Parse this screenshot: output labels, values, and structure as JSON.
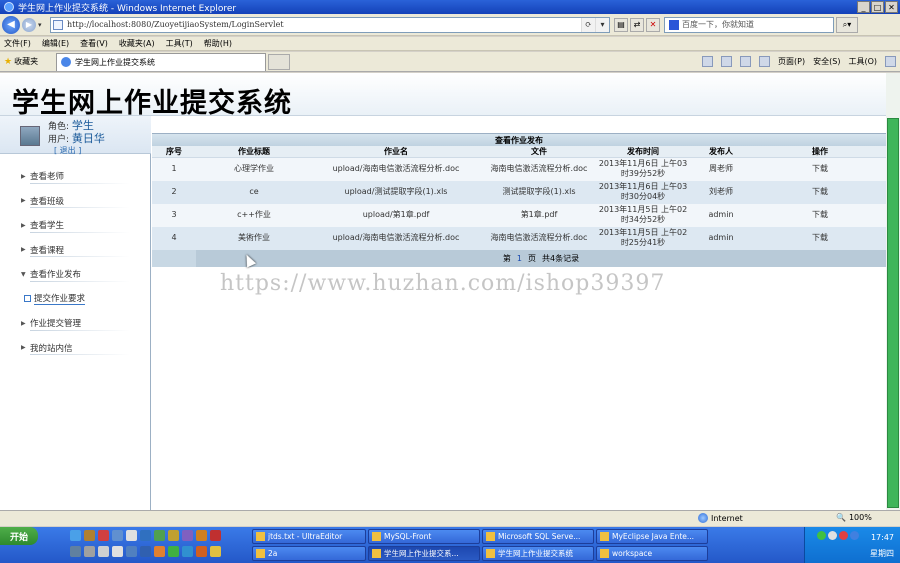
{
  "browser": {
    "window_title": "学生网上作业提交系统 - Windows Internet Explorer",
    "url": "http://localhost:8080/ZuoyetijiaoSystem/LoginServlet",
    "search_placeholder": "百度一下，你就知道",
    "menu": [
      "文件(F)",
      "编辑(E)",
      "查看(V)",
      "收藏夹(A)",
      "工具(T)",
      "帮助(H)"
    ],
    "favorites_label": "收藏夹",
    "tab_title": "学生网上作业提交系统",
    "command_bar": {
      "page": "页面(P)",
      "safety": "安全(S)",
      "tools": "工具(O)"
    },
    "status_zone": "Internet",
    "zoom": "100%"
  },
  "header": {
    "system_title": "学生网上作业提交系统"
  },
  "user": {
    "role_label": "角色:",
    "role": "学生",
    "name_label": "用户:",
    "name": "黄日华",
    "logout": "[ 退出 ]"
  },
  "sidebar": {
    "items": [
      {
        "label": "查看老师"
      },
      {
        "label": "查看班级"
      },
      {
        "label": "查看学生"
      },
      {
        "label": "查看课程"
      },
      {
        "label": "查看作业发布"
      },
      {
        "label": "提交作业要求"
      },
      {
        "label": "作业提交管理"
      },
      {
        "label": "我的站内信"
      }
    ]
  },
  "table": {
    "caption": "查看作业发布",
    "headers": [
      "序号",
      "作业标题",
      "作业名",
      "文件",
      "发布时间",
      "发布人",
      "操作"
    ],
    "rows": [
      {
        "no": "1",
        "title": "心理学作业",
        "name": "upload/海南电信激活流程分析.doc",
        "file": "海南电信激活流程分析.doc",
        "time": "2013年11月6日 上午03时39分52秒",
        "publisher": "周老师",
        "action": "下载"
      },
      {
        "no": "2",
        "title": "ce",
        "name": "upload/测试提取字段(1).xls",
        "file": "测试提取字段(1).xls",
        "time": "2013年11月6日 上午03时30分04秒",
        "publisher": "刘老师",
        "action": "下载"
      },
      {
        "no": "3",
        "title": "c++作业",
        "name": "upload/第1章.pdf",
        "file": "第1章.pdf",
        "time": "2013年11月5日 上午02时34分52秒",
        "publisher": "admin",
        "action": "下载"
      },
      {
        "no": "4",
        "title": "美術作业",
        "name": "upload/海南电信激活流程分析.doc",
        "file": "海南电信激活流程分析.doc",
        "time": "2013年11月5日 上午02时25分41秒",
        "publisher": "admin",
        "action": "下载"
      }
    ],
    "pager": {
      "prefix": "第",
      "page": "1",
      "suffix": "页",
      "total": "共4条记录"
    }
  },
  "watermark": "https://www.huzhan.com/ishop39397",
  "taskbar": {
    "start": "开始",
    "buttons": [
      "jtds.txt - UltraEditor",
      "MySQL-Front",
      "Microsoft SQL Serve...",
      "MyEclipse Java Ente...",
      "2a",
      "学生网上作业提交系...",
      "学生网上作业提交系统",
      "workspace"
    ],
    "time": "17:47",
    "day": "星期四"
  },
  "colors": {
    "accent": "#1a4a90",
    "scrollbar": "#3fb55a",
    "taskbar": "#2458c8"
  }
}
